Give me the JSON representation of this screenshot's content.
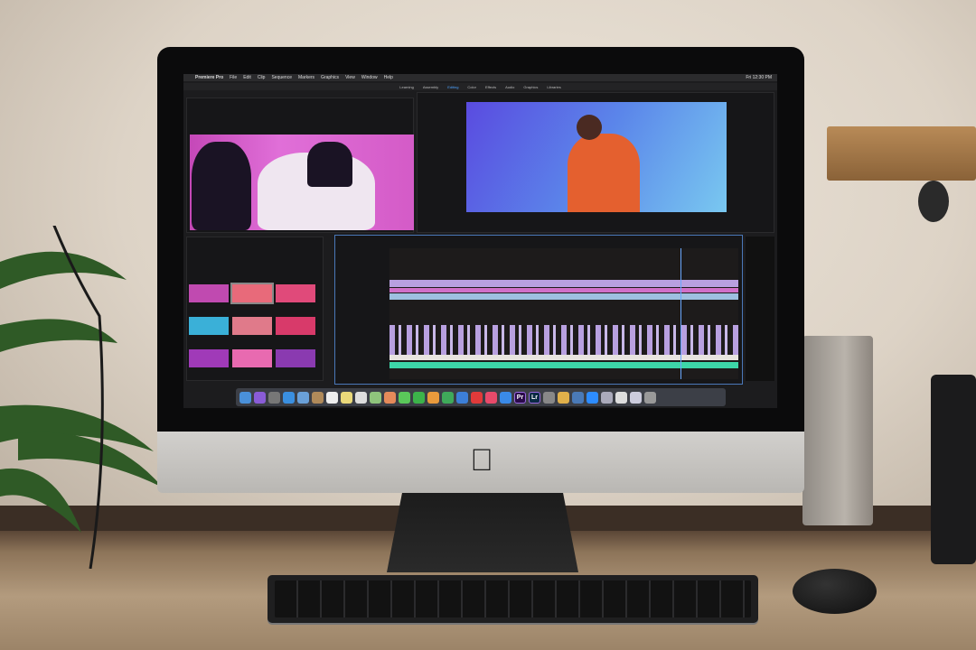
{
  "menubar": {
    "items": [
      "Premiere Pro",
      "File",
      "Edit",
      "Clip",
      "Sequence",
      "Markers",
      "Graphics",
      "View",
      "Window",
      "Help"
    ],
    "status": "Fri 12:30 PM"
  },
  "workspaces": {
    "items": [
      "Learning",
      "Assembly",
      "Editing",
      "Color",
      "Effects",
      "Audio",
      "Graphics",
      "Libraries"
    ],
    "active": "Editing"
  },
  "dock": {
    "apps": [
      {
        "icon": "finder-icon",
        "color": "#4a90d9",
        "label": ""
      },
      {
        "icon": "siri-icon",
        "color": "#8a5cd8",
        "label": ""
      },
      {
        "icon": "launchpad-icon",
        "color": "#777",
        "label": ""
      },
      {
        "icon": "safari-icon",
        "color": "#3a8fe0",
        "label": ""
      },
      {
        "icon": "mail-icon",
        "color": "#6aa0d8",
        "label": ""
      },
      {
        "icon": "contacts-icon",
        "color": "#b08a5a",
        "label": ""
      },
      {
        "icon": "calendar-icon",
        "color": "#eee",
        "label": ""
      },
      {
        "icon": "notes-icon",
        "color": "#e9d87a",
        "label": ""
      },
      {
        "icon": "reminders-icon",
        "color": "#ddd",
        "label": ""
      },
      {
        "icon": "maps-icon",
        "color": "#8fc47c",
        "label": ""
      },
      {
        "icon": "photos-icon",
        "color": "#e58a5a",
        "label": ""
      },
      {
        "icon": "messages-icon",
        "color": "#5ac85a",
        "label": ""
      },
      {
        "icon": "facetime-icon",
        "color": "#3cb34a",
        "label": ""
      },
      {
        "icon": "pages-icon",
        "color": "#e99a3c",
        "label": ""
      },
      {
        "icon": "numbers-icon",
        "color": "#3faa5a",
        "label": ""
      },
      {
        "icon": "keynote-icon",
        "color": "#3c7fd8",
        "label": ""
      },
      {
        "icon": "news-icon",
        "color": "#e03a3a",
        "label": ""
      },
      {
        "icon": "music-icon",
        "color": "#e84a6a",
        "label": ""
      },
      {
        "icon": "app-store-icon",
        "color": "#3a8ae8",
        "label": ""
      },
      {
        "icon": "premiere-pro-icon",
        "color": "#2a0a4a",
        "label": "Pr"
      },
      {
        "icon": "lightroom-icon",
        "color": "#0a2a44",
        "label": "Lr"
      },
      {
        "icon": "system-preferences-icon",
        "color": "#888",
        "label": ""
      },
      {
        "icon": "folder-icon",
        "color": "#e0b04a",
        "label": ""
      },
      {
        "icon": "quicktime-icon",
        "color": "#4a7ab8",
        "label": ""
      },
      {
        "icon": "zoom-icon",
        "color": "#2d8cff",
        "label": ""
      },
      {
        "icon": "preview-icon",
        "color": "#aab",
        "label": ""
      },
      {
        "icon": "document-icon",
        "color": "#ddd",
        "label": ""
      },
      {
        "icon": "downloads-icon",
        "color": "#ccd",
        "label": ""
      },
      {
        "icon": "trash-icon",
        "color": "#999",
        "label": ""
      }
    ]
  },
  "colors": {
    "source_monitor": "#d45bc7",
    "program_monitor": "#5b86ea",
    "timeline_border": "#4a78b8",
    "video_clip": "#b8a0e0",
    "audio_clip": "#3dd6a8"
  },
  "logo": {
    "icon": "apple-logo-icon"
  }
}
